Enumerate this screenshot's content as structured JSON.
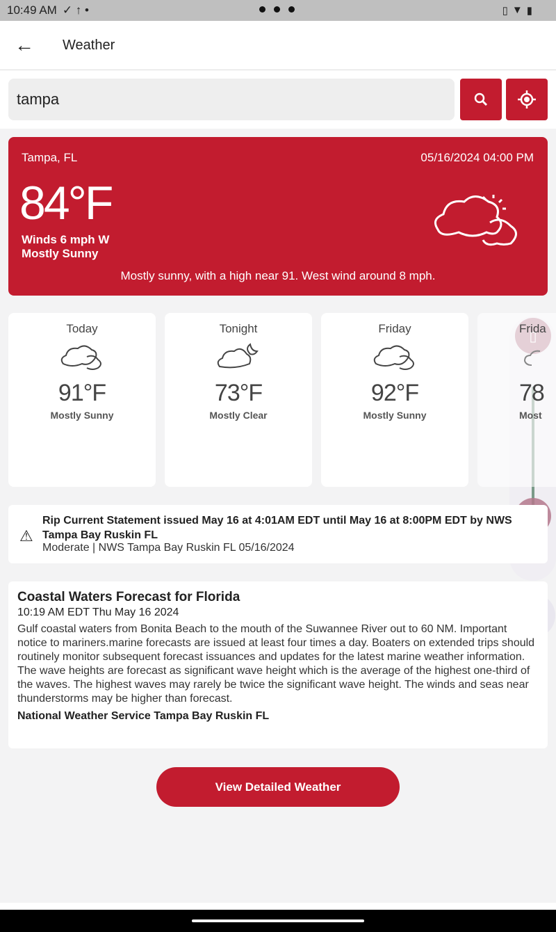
{
  "status_bar": {
    "time": "10:49 AM"
  },
  "app_bar": {
    "title": "Weather"
  },
  "search": {
    "value": "tampa"
  },
  "current": {
    "location": "Tampa, FL",
    "datetime": "05/16/2024 04:00 PM",
    "temperature": "84°F",
    "wind": "Winds 6 mph W",
    "condition": "Mostly Sunny",
    "description": "Mostly sunny, with a high near 91. West wind around 8 mph.",
    "icon": "partly-sunny-icon"
  },
  "forecast": [
    {
      "label": "Today",
      "temp": "91°F",
      "condition": "Mostly Sunny",
      "icon": "partly-sunny-icon"
    },
    {
      "label": "Tonight",
      "temp": "73°F",
      "condition": "Mostly Clear",
      "icon": "partly-cloudy-night-icon"
    },
    {
      "label": "Friday",
      "temp": "92°F",
      "condition": "Mostly Sunny",
      "icon": "partly-sunny-icon"
    },
    {
      "label": "Frida",
      "temp": "78",
      "condition": "Most",
      "icon": "cloud-icon"
    }
  ],
  "alert": {
    "headline": "Rip Current Statement issued May 16 at 4:01AM EDT until May 16 at 8:00PM EDT by NWS Tampa Bay Ruskin FL",
    "sub": "Moderate | NWS Tampa Bay Ruskin FL 05/16/2024"
  },
  "coastal": {
    "title": "Coastal Waters Forecast for Florida",
    "date": "10:19 AM EDT Thu May 16 2024",
    "body": "Gulf coastal waters from Bonita Beach to the mouth of the Suwannee River out to 60 NM. Important notice to mariners.marine forecasts are issued at least four times a day. Boaters on extended trips should routinely monitor subsequent forecast issuances and updates for the latest marine weather information. The wave heights are forecast as significant wave height which is the average of the highest one-third of the waves. The highest waves may rarely be twice the significant wave height. The winds and seas near thunderstorms may be higher than forecast.",
    "footer": "National Weather Service Tampa Bay Ruskin FL"
  },
  "view_button": "View Detailed Weather",
  "colors": {
    "accent": "#c21c2f"
  }
}
